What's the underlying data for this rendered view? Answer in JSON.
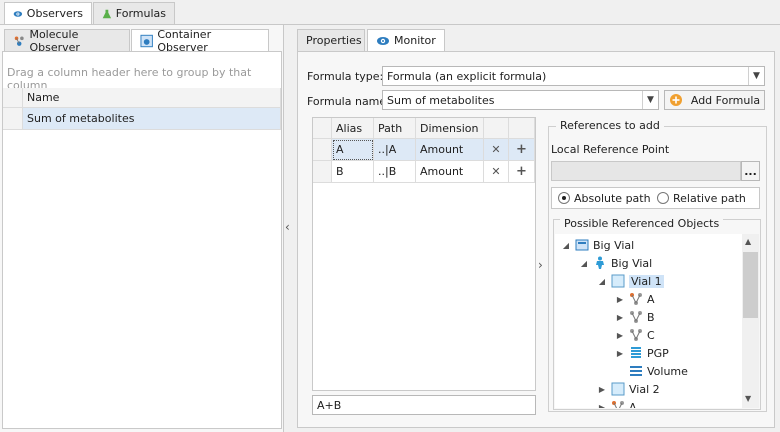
{
  "top_tabs": [
    {
      "label": "Observers",
      "icon": "eye-icon"
    },
    {
      "label": "Formulas",
      "icon": "flask-icon"
    }
  ],
  "left": {
    "tabs": [
      {
        "label": "Molecule Observer",
        "icon": "molecule-observer-icon"
      },
      {
        "label": "Container Observer",
        "icon": "container-observer-icon"
      }
    ],
    "group_hint": "Drag a column header here to group by that column",
    "column_name": "Name",
    "rows": [
      "Sum of metabolites"
    ]
  },
  "right": {
    "tabs": [
      {
        "label": "Properties"
      },
      {
        "label": "Monitor",
        "icon": "eye-icon"
      }
    ],
    "formula_type_label": "Formula type:",
    "formula_type_value": "Formula (an explicit formula)",
    "formula_name_label": "Formula name:",
    "formula_name_value": "Sum of metabolites",
    "add_formula_label": "Add Formula",
    "table_headers": [
      "Alias",
      "Path",
      "Dimension"
    ],
    "table_rows": [
      {
        "alias": "A",
        "path": "..|A",
        "dimension": "Amount"
      },
      {
        "alias": "B",
        "path": "..|B",
        "dimension": "Amount"
      }
    ],
    "formula_text": "A+B",
    "references": {
      "title": "References to add",
      "local_ref_label": "Local Reference Point",
      "local_ref_value": "",
      "browse_label": "...",
      "absolute_label": "Absolute path",
      "relative_label": "Relative path",
      "possible_title": "Possible Referenced Objects",
      "tree": [
        {
          "label": "Big Vial",
          "icon": "spatial-structure-icon",
          "exp": "◢"
        },
        {
          "label": "Big Vial",
          "icon": "individual-icon",
          "exp": "◢"
        },
        {
          "label": "Vial 1",
          "icon": "container-icon",
          "exp": "◢"
        },
        {
          "label": "A",
          "icon": "molecule-icon",
          "exp": "▶"
        },
        {
          "label": "B",
          "icon": "molecule-icon",
          "exp": "▶"
        },
        {
          "label": "C",
          "icon": "molecule-icon",
          "exp": "▶"
        },
        {
          "label": "PGP",
          "icon": "protein-icon",
          "exp": "▶"
        },
        {
          "label": "Volume",
          "icon": "parameter-icon",
          "exp": ""
        },
        {
          "label": "Vial 2",
          "icon": "container-icon",
          "exp": "▶"
        },
        {
          "label": "A",
          "icon": "molecule-icon",
          "exp": "▶"
        }
      ]
    }
  },
  "colors": {
    "accent": "#2e7dbf",
    "selection": "#cfe3f7",
    "orange": "#f0a030"
  }
}
